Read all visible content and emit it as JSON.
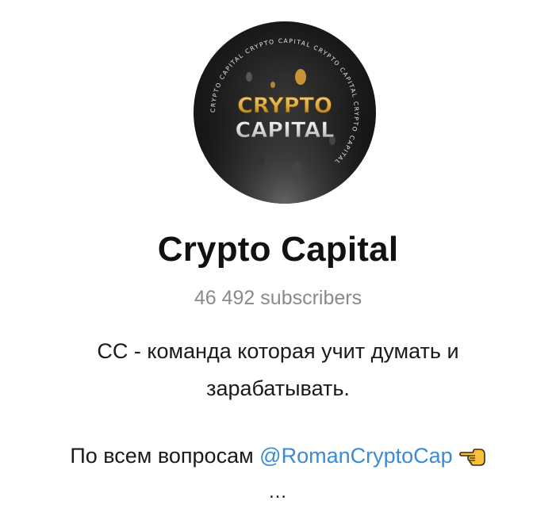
{
  "channel": {
    "avatar": {
      "logo_line1": "CRYPTO",
      "logo_line2": "CAPITAL",
      "ring_text": "CRYPTO CAPITAL CRYPTO CAPITAL CRYPTO CAPITAL CRYPTO CAPITAL",
      "logo_color": "#d9a53a"
    },
    "title": "Crypto Capital",
    "subscribers": "46 492 subscribers",
    "description_line1": "CC - команда которая учит думать и",
    "description_line2": "зарабатывать.",
    "contact_prefix": "По всем вопросам ",
    "contact_mention": "@RomanCryptoCap",
    "contact_icon": "pointing-hand-left-icon",
    "more": "…",
    "colors": {
      "mention": "#3a8bd6",
      "subscribers": "#8a8a8a",
      "title": "#111111"
    }
  }
}
